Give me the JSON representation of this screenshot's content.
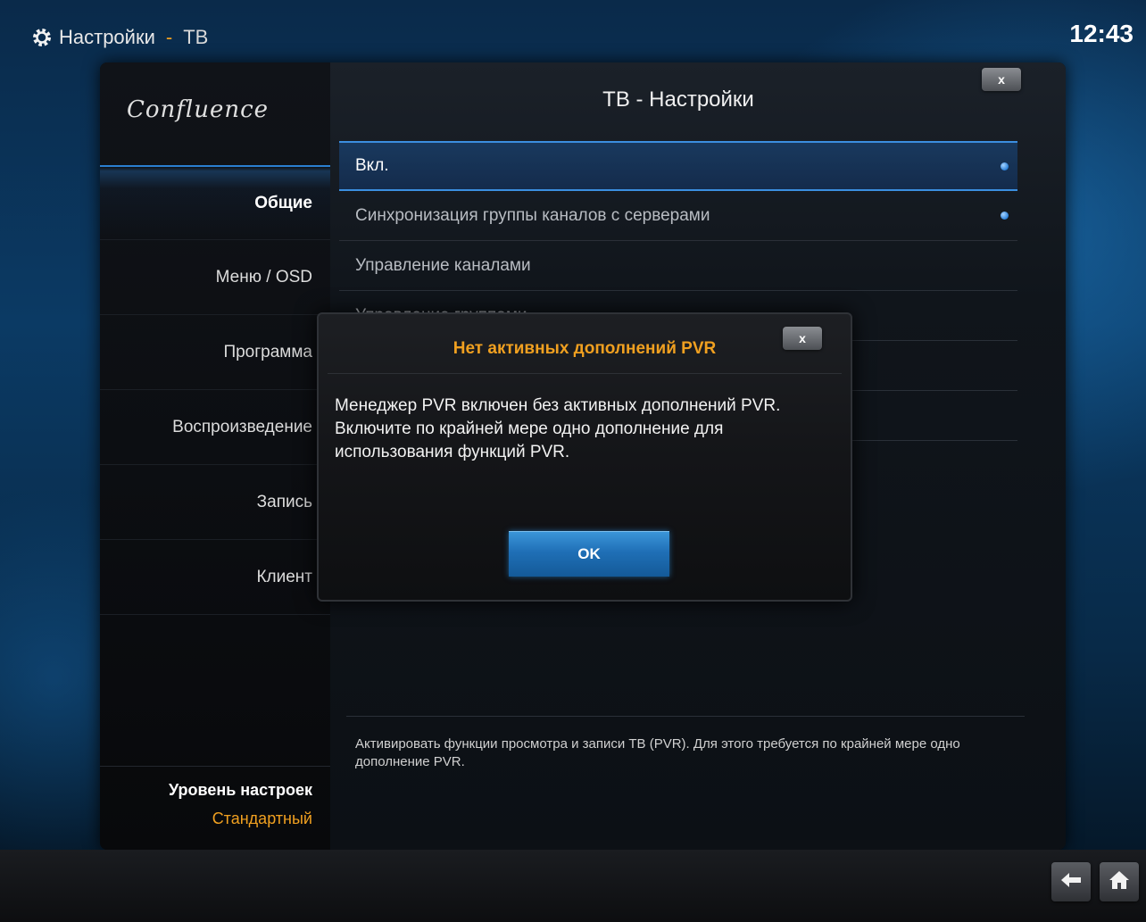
{
  "header": {
    "app_title": "Настройки",
    "separator": "-",
    "section": "ТВ",
    "clock": "12:43"
  },
  "sidebar": {
    "logo": "Confluence",
    "items": [
      {
        "label": "Общие"
      },
      {
        "label": "Меню / OSD"
      },
      {
        "label": "Программа"
      },
      {
        "label": "Воспроизведение"
      },
      {
        "label": "Запись"
      },
      {
        "label": "Клиент"
      }
    ],
    "level_label": "Уровень настроек",
    "level_value": "Стандартный"
  },
  "content": {
    "title": "ТВ - Настройки",
    "close_label": "x",
    "settings": [
      {
        "label": "Вкл."
      },
      {
        "label": "Синхронизация группы каналов с серверами"
      },
      {
        "label": "Управление каналами"
      },
      {
        "label": "Управление группами"
      }
    ],
    "description": "Активировать функции просмотра и записи ТВ (PVR). Для этого требуется по крайней мере одно дополнение PVR."
  },
  "dialog": {
    "title": "Нет активных дополнений PVR",
    "close_label": "x",
    "message": "Менеджер PVR включен без активных дополнений PVR. Включите по крайней мере одно дополнение для использования функций PVR.",
    "ok_label": "OK"
  },
  "icons": {
    "gear": "gear-icon",
    "back": "back-arrow-icon",
    "home": "home-icon"
  },
  "colors": {
    "accent": "#f0a020",
    "highlight": "#2a7fd0"
  }
}
